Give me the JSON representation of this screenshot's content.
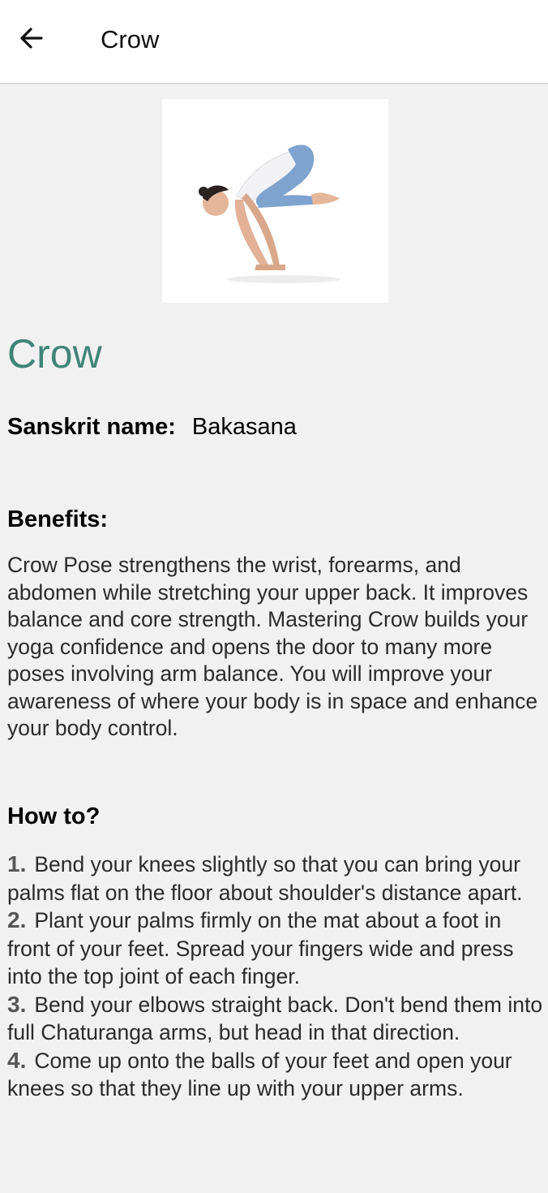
{
  "header": {
    "back_icon": "arrow-left-icon",
    "title": "Crow"
  },
  "pose": {
    "image_icon": "yoga-crow-pose-photo",
    "name": "Crow",
    "sanskrit_label": "Sanskrit name:",
    "sanskrit_value": "Bakasana",
    "accent_color": "#3f8577"
  },
  "benefits": {
    "heading": "Benefits:",
    "text": "Crow Pose strengthens the wrist, forearms, and abdomen while stretching your upper back. It improves balance and core strength. Mastering Crow builds your yoga confidence and opens the door to many more poses involving arm balance. You will improve your awareness of where your body is in space and enhance your body control."
  },
  "howto": {
    "heading": "How to?",
    "steps": [
      {
        "num": "1.",
        "text": "Bend your knees slightly so that you can bring your palms flat on the floor about shoulder's distance apart."
      },
      {
        "num": "2.",
        "text": "Plant your palms firmly on the mat about a foot in front of your feet. Spread your fingers wide and press into the top joint of each finger."
      },
      {
        "num": "3.",
        "text": "Bend your elbows straight back. Don't bend them into full Chaturanga arms, but head in that direction."
      },
      {
        "num": "4.",
        "text": "Come up onto the balls of your feet and open your knees so that they line up with your upper arms."
      }
    ]
  }
}
